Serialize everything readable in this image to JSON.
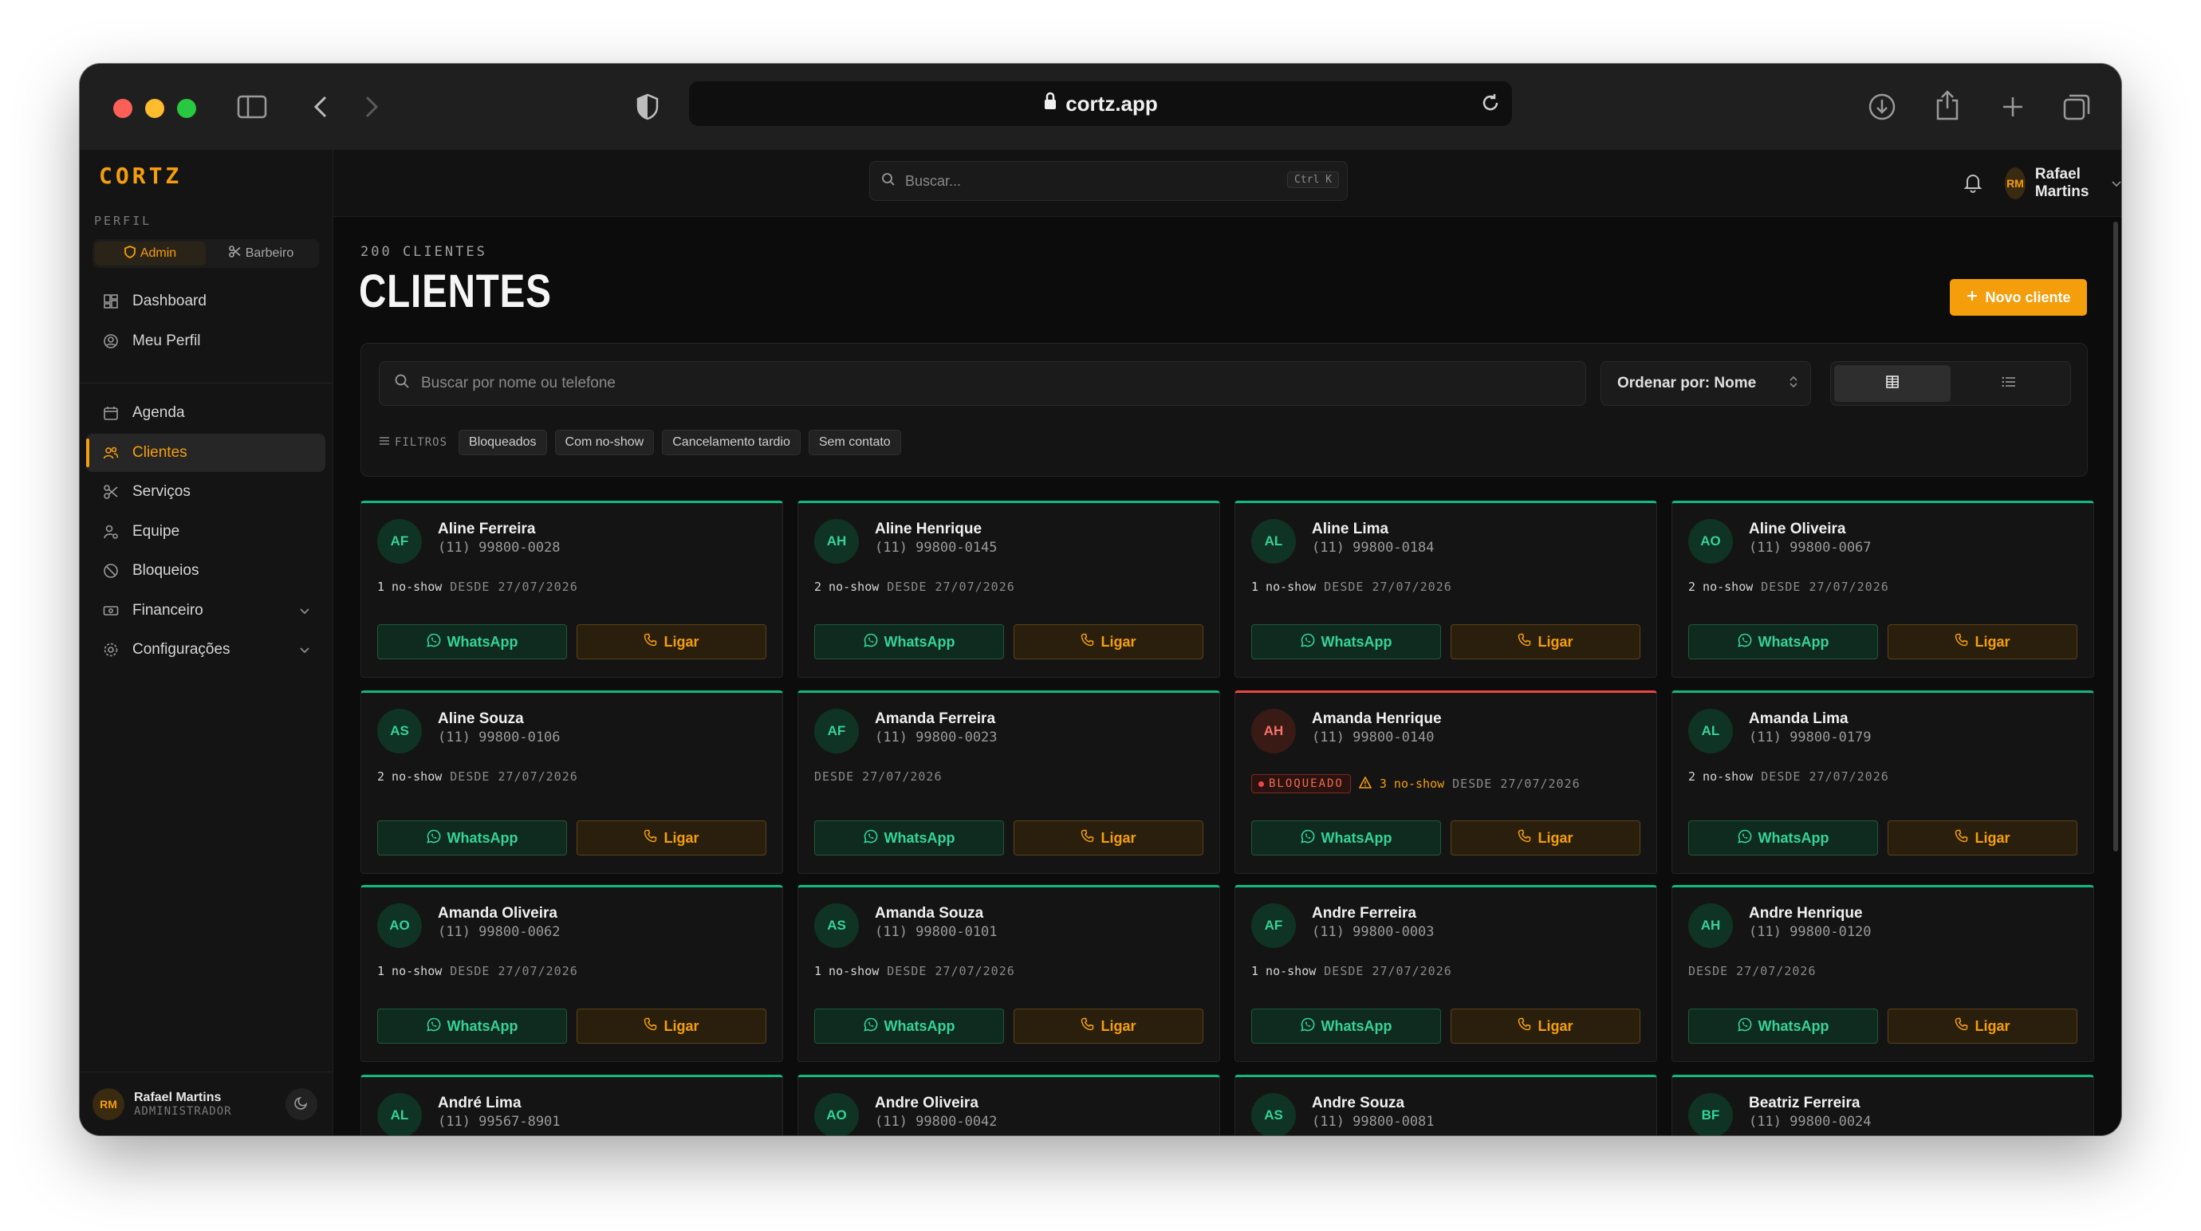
{
  "browser": {
    "url": "cortz.app"
  },
  "app": {
    "brand": "CORTZ",
    "profile_label": "PERFIL",
    "roles": [
      "Admin",
      "Barbeiro"
    ]
  },
  "nav": {
    "group1": [
      "Dashboard",
      "Meu Perfil"
    ],
    "group2": [
      "Agenda",
      "Clientes",
      "Serviços",
      "Equipe",
      "Bloqueios",
      "Financeiro",
      "Configurações"
    ],
    "active": "Clientes"
  },
  "sidebar_user": {
    "initials": "RM",
    "name": "Rafael Martins",
    "role": "ADMINISTRADOR"
  },
  "topbar": {
    "search_placeholder": "Buscar...",
    "shortcut": "Ctrl K",
    "user_initials": "RM",
    "user_name": "Rafael Martins"
  },
  "page": {
    "count": "200 CLIENTES",
    "title": "CLIENTES",
    "new_button": "Novo cliente"
  },
  "filters": {
    "search_placeholder": "Buscar por nome ou telefone",
    "order_label": "Ordenar por: Nome",
    "filters_label": "FILTROS",
    "chips": [
      "Bloqueados",
      "Com no-show",
      "Cancelamento tardio",
      "Sem contato"
    ]
  },
  "labels": {
    "whatsapp": "WhatsApp",
    "call": "Ligar",
    "blocked": "BLOQUEADO"
  },
  "colors": {
    "accent": "#f59e0b",
    "success": "#10b981",
    "danger": "#ef4444"
  },
  "clients": [
    {
      "initials": "AF",
      "name": "Aline Ferreira",
      "phone": "(11) 99800-0028",
      "noshow": "1 no-show",
      "since": "DESDE 27/07/2026",
      "blocked": false
    },
    {
      "initials": "AH",
      "name": "Aline Henrique",
      "phone": "(11) 99800-0145",
      "noshow": "2 no-show",
      "since": "DESDE 27/07/2026",
      "blocked": false
    },
    {
      "initials": "AL",
      "name": "Aline Lima",
      "phone": "(11) 99800-0184",
      "noshow": "1 no-show",
      "since": "DESDE 27/07/2026",
      "blocked": false
    },
    {
      "initials": "AO",
      "name": "Aline Oliveira",
      "phone": "(11) 99800-0067",
      "noshow": "2 no-show",
      "since": "DESDE 27/07/2026",
      "blocked": false
    },
    {
      "initials": "AS",
      "name": "Aline Souza",
      "phone": "(11) 99800-0106",
      "noshow": "2 no-show",
      "since": "DESDE 27/07/2026",
      "blocked": false
    },
    {
      "initials": "AF",
      "name": "Amanda Ferreira",
      "phone": "(11) 99800-0023",
      "noshow": "",
      "since": "DESDE 27/07/2026",
      "blocked": false
    },
    {
      "initials": "AH",
      "name": "Amanda Henrique",
      "phone": "(11) 99800-0140",
      "noshow": "3 no-show",
      "since": "DESDE 27/07/2026",
      "blocked": true
    },
    {
      "initials": "AL",
      "name": "Amanda Lima",
      "phone": "(11) 99800-0179",
      "noshow": "2 no-show",
      "since": "DESDE 27/07/2026",
      "blocked": false
    },
    {
      "initials": "AO",
      "name": "Amanda Oliveira",
      "phone": "(11) 99800-0062",
      "noshow": "1 no-show",
      "since": "DESDE 27/07/2026",
      "blocked": false
    },
    {
      "initials": "AS",
      "name": "Amanda Souza",
      "phone": "(11) 99800-0101",
      "noshow": "1 no-show",
      "since": "DESDE 27/07/2026",
      "blocked": false
    },
    {
      "initials": "AF",
      "name": "Andre Ferreira",
      "phone": "(11) 99800-0003",
      "noshow": "1 no-show",
      "since": "DESDE 27/07/2026",
      "blocked": false
    },
    {
      "initials": "AH",
      "name": "Andre Henrique",
      "phone": "(11) 99800-0120",
      "noshow": "",
      "since": "DESDE 27/07/2026",
      "blocked": false
    },
    {
      "initials": "AL",
      "name": "André Lima",
      "phone": "(11) 99567-8901",
      "noshow": "",
      "since": "",
      "blocked": false
    },
    {
      "initials": "AO",
      "name": "Andre Oliveira",
      "phone": "(11) 99800-0042",
      "noshow": "",
      "since": "",
      "blocked": false
    },
    {
      "initials": "AS",
      "name": "Andre Souza",
      "phone": "(11) 99800-0081",
      "noshow": "",
      "since": "",
      "blocked": false
    },
    {
      "initials": "BF",
      "name": "Beatriz Ferreira",
      "phone": "(11) 99800-0024",
      "noshow": "",
      "since": "",
      "blocked": false
    }
  ]
}
